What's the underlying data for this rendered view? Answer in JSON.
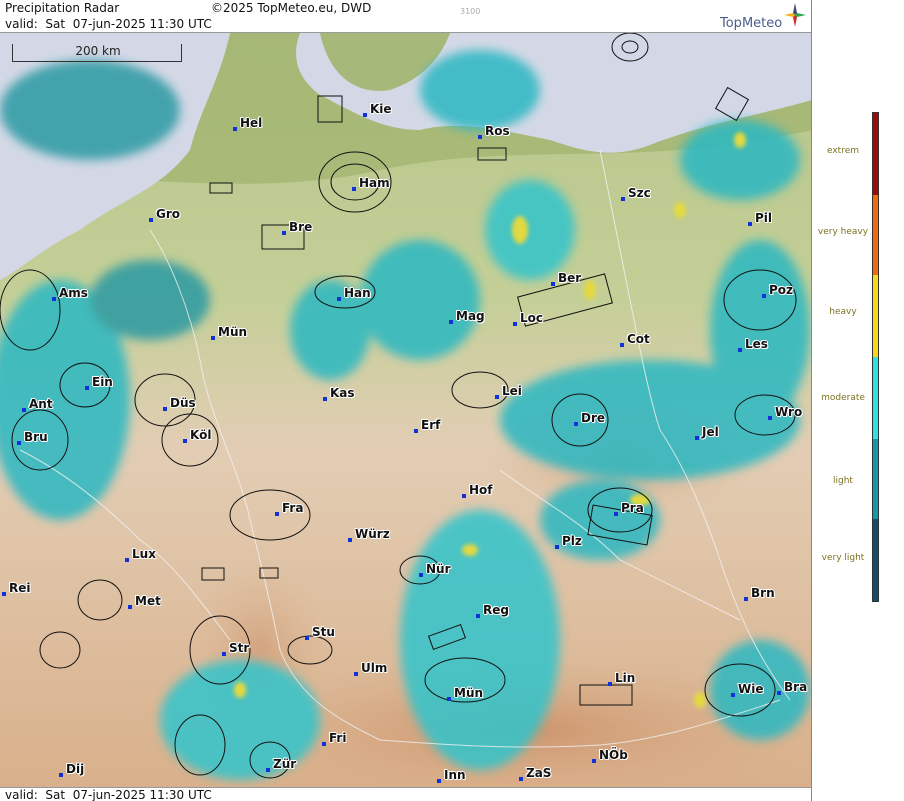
{
  "header": {
    "title": "Precipitation Radar",
    "copyright": "©2025 TopMeteo.eu, DWD",
    "code": "3100",
    "valid_top": "valid:  Sat  07-jun-2025 11:30 UTC",
    "brand": "TopMeteo"
  },
  "footer": {
    "valid_bottom": "valid:  Sat  07-jun-2025 11:30 UTC"
  },
  "map": {
    "scale_label": "200 km",
    "cities": [
      "Hel",
      "Kie",
      "Ros",
      "Ham",
      "Szc",
      "Gro",
      "Bre",
      "Pil",
      "Ber",
      "Ams",
      "Han",
      "Mag",
      "Loc",
      "Poz",
      "Mün",
      "Cot",
      "Les",
      "Ein",
      "Kas",
      "Lei",
      "Ant",
      "Düs",
      "Dre",
      "Wro",
      "Bru",
      "Köl",
      "Erf",
      "Jel",
      "Hof",
      "Fra",
      "Pra",
      "Würz",
      "Plz",
      "Lux",
      "Nür",
      "Rei",
      "Met",
      "Brn",
      "Reg",
      "Stu",
      "Str",
      "Ulm",
      "Lin",
      "Mün",
      "Wie",
      "Bra",
      "Fri",
      "Dij",
      "Zür",
      "NÖb",
      "Inn",
      "ZaS"
    ]
  },
  "legend": {
    "items": [
      {
        "label": "extrem",
        "color": "#a00a0a"
      },
      {
        "label": "very heavy",
        "color": "#f06a10"
      },
      {
        "label": "heavy",
        "color": "#f7d81a"
      },
      {
        "label": "moderate",
        "color": "#2ee2e2"
      },
      {
        "label": "light",
        "color": "#139aa8"
      },
      {
        "label": "very light",
        "color": "#164e6a"
      }
    ]
  }
}
